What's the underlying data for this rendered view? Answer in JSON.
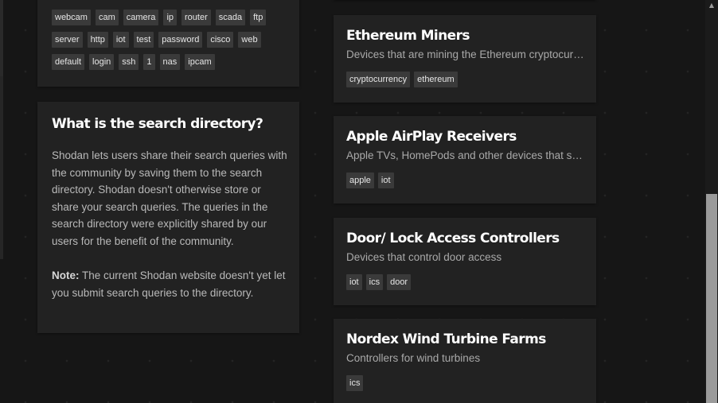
{
  "tag_cloud": {
    "tags": [
      "webcam",
      "cam",
      "camera",
      "ip",
      "router",
      "scada",
      "ftp",
      "server",
      "http",
      "iot",
      "test",
      "password",
      "cisco",
      "web",
      "default",
      "login",
      "ssh",
      "1",
      "nas",
      "ipcam"
    ]
  },
  "about": {
    "title": "What is the search directory?",
    "body": "Shodan lets users share their search queries with the community by saving them to the search directory. Shodan doesn't otherwise store or share your search queries. The queries in the search directory were explicitly shared by our users for the benefit of the community.",
    "note_label": "Note:",
    "note_text": " The current Shodan website doesn't yet let you submit search queries to the directory."
  },
  "queries": [
    {
      "title": "Ethereum Miners",
      "description": "Devices that are mining the Ethereum cryptocurrency",
      "tags": [
        "cryptocurrency",
        "ethereum"
      ]
    },
    {
      "title": "Apple AirPlay Receivers",
      "description": "Apple TVs, HomePods and other devices that support AirPlay",
      "tags": [
        "apple",
        "iot"
      ]
    },
    {
      "title": "Door/ Lock Access Controllers",
      "description": "Devices that control door access",
      "tags": [
        "iot",
        "ics",
        "door"
      ]
    },
    {
      "title": "Nordex Wind Turbine Farms",
      "description": "Controllers for wind turbines",
      "tags": [
        "ics"
      ]
    }
  ],
  "scrollbar": {
    "up_arrow_icon": "triangle-up",
    "position_fraction": 0.48
  }
}
